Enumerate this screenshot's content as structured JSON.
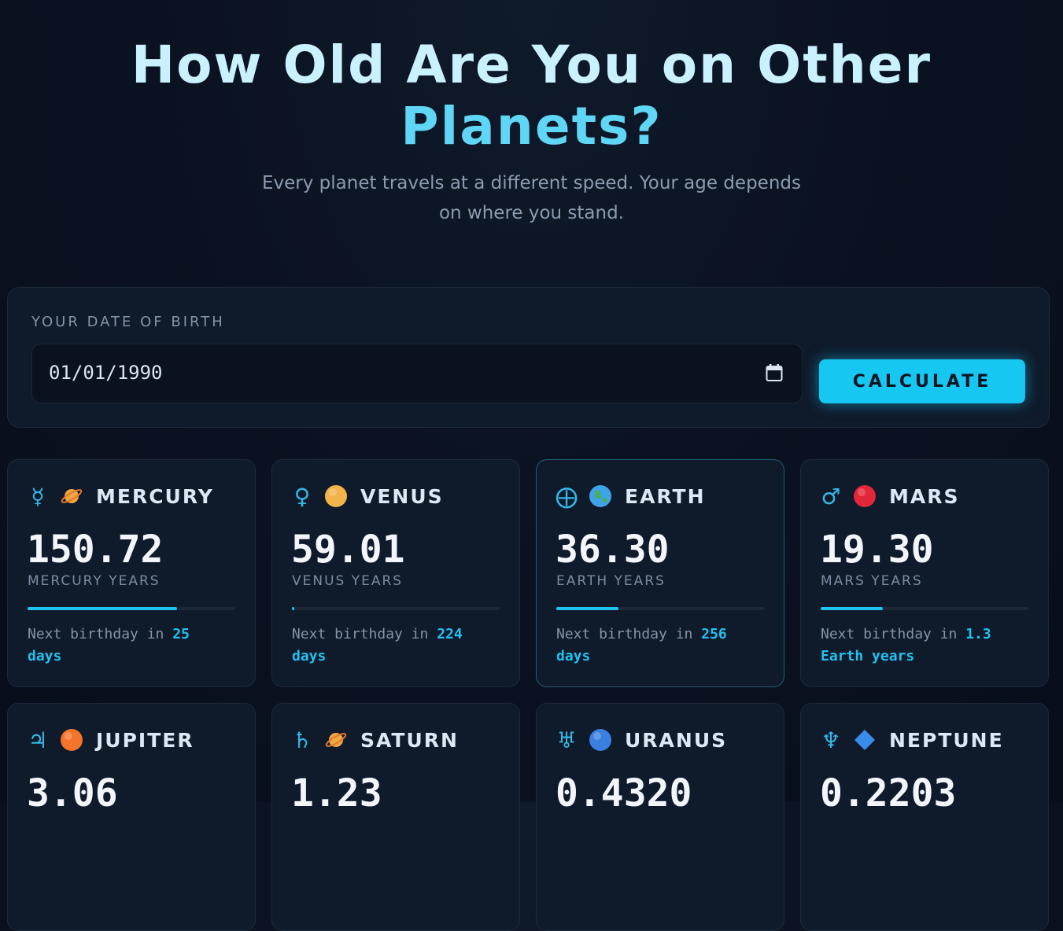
{
  "hero": {
    "title_main": "How Old Are You on Other",
    "title_accent": "Planets?",
    "subtitle_line1": "Every planet travels at a different speed. Your age depends",
    "subtitle_line2": "on where you stand."
  },
  "form": {
    "label": "YOUR DATE OF BIRTH",
    "date_value": "01/01/1990",
    "calendar_icon": "calendar-icon",
    "button_label": "CALCULATE"
  },
  "colors": {
    "accent": "#16c7f2",
    "background": "#0a1120",
    "card": "#0f1a2b"
  },
  "planets": [
    {
      "symbol": "☿",
      "emoji_icon": "planet-ringed-icon",
      "emoji_color": "#f2a541",
      "name": "MERCURY",
      "age": "150.72",
      "unit": "MERCURY YEARS",
      "progress": 0.72,
      "next_prefix": "Next birthday in",
      "next_value": "25",
      "next_suffix": "days",
      "active": false
    },
    {
      "symbol": "♀",
      "emoji_icon": "venus-globe-icon",
      "emoji_color": "#f4b24a",
      "name": "VENUS",
      "age": "59.01",
      "unit": "VENUS YEARS",
      "progress": 0.01,
      "next_prefix": "Next birthday in",
      "next_value": "224",
      "next_suffix": "days",
      "active": false
    },
    {
      "symbol": "⨁",
      "emoji_icon": "earth-globe-icon",
      "emoji_color": "#3fa3e8",
      "name": "EARTH",
      "age": "36.30",
      "unit": "EARTH YEARS",
      "progress": 0.3,
      "next_prefix": "Next birthday in",
      "next_value": "256",
      "next_suffix": "days",
      "active": true
    },
    {
      "symbol": "♂",
      "emoji_icon": "red-circle-icon",
      "emoji_color": "#e3263a",
      "name": "MARS",
      "age": "19.30",
      "unit": "MARS YEARS",
      "progress": 0.3,
      "next_prefix": "Next birthday in",
      "next_value": "1.3",
      "next_suffix": "Earth years",
      "active": false
    },
    {
      "symbol": "♃",
      "emoji_icon": "orange-circle-icon",
      "emoji_color": "#f4742c",
      "name": "JUPITER",
      "age": "3.06",
      "active": false
    },
    {
      "symbol": "♄",
      "emoji_icon": "planet-ringed-icon",
      "emoji_color": "#f2a541",
      "name": "SATURN",
      "age": "1.23",
      "active": false
    },
    {
      "symbol": "♅",
      "emoji_icon": "blue-circle-icon",
      "emoji_color": "#3b7fe0",
      "name": "URANUS",
      "age": "0.4320",
      "active": false
    },
    {
      "symbol": "♆",
      "emoji_icon": "blue-diamond-icon",
      "emoji_color": "#3b8be8",
      "name": "NEPTUNE",
      "age": "0.2203",
      "active": false
    }
  ]
}
